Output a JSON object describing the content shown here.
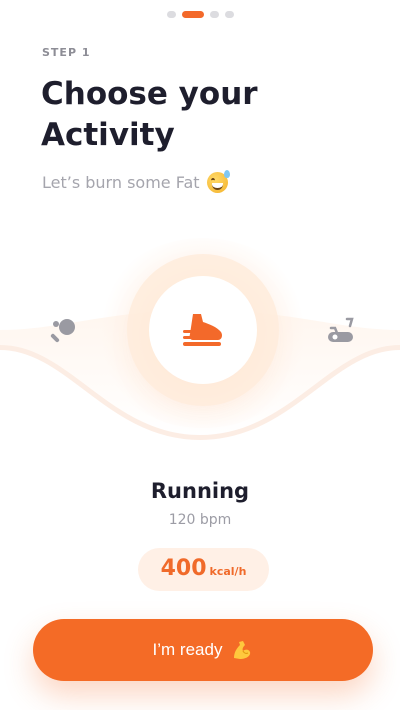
{
  "pager": {
    "total": 4,
    "active_index": 1
  },
  "header": {
    "step": "STEP 1",
    "title": "Choose your Activity",
    "subtitle": "Let’s burn some Fat"
  },
  "carousel": {
    "items": [
      {
        "name": "table-tennis",
        "icon": "ping-pong-icon"
      },
      {
        "name": "running",
        "icon": "running-shoe-icon"
      },
      {
        "name": "exercise-bike",
        "icon": "exercise-bike-icon"
      }
    ],
    "selected_index": 1
  },
  "activity": {
    "name": "Running",
    "bpm": "120 bpm",
    "kcal_value": "400",
    "kcal_unit": "kcal/h"
  },
  "cta": {
    "label": "I’m ready",
    "icon": "flexed-biceps-icon"
  },
  "colors": {
    "accent": "#f46b26",
    "accent_soft": "#fff0e6",
    "text_dark": "#1e1e2d",
    "text_muted": "#a5a5ad"
  }
}
